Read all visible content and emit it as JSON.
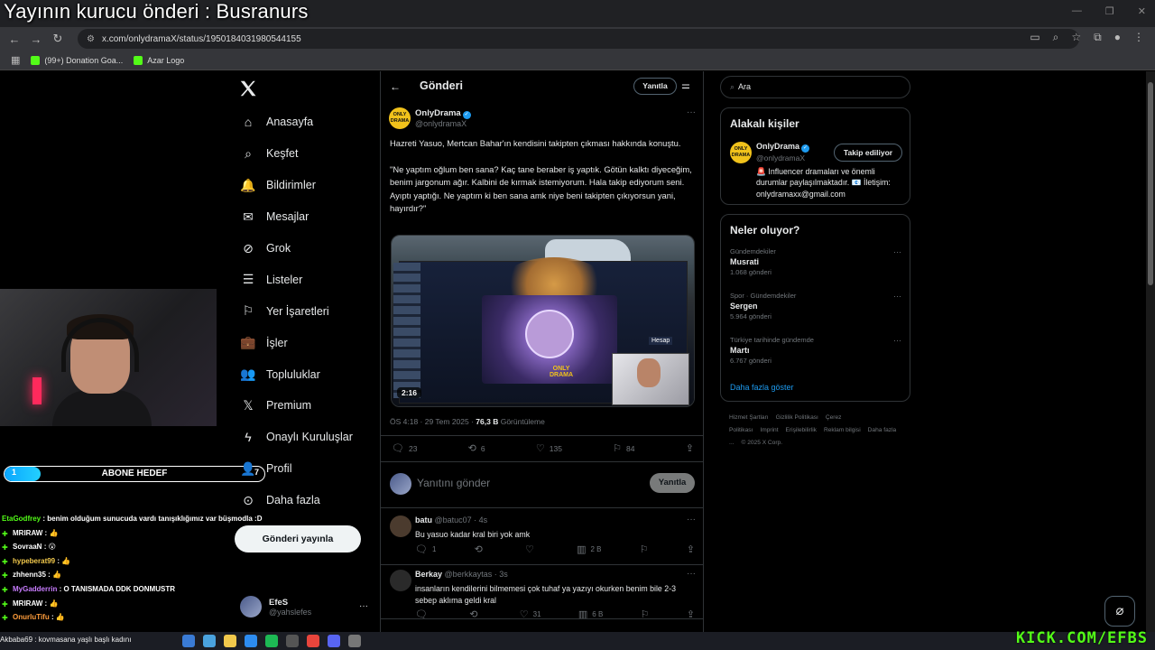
{
  "stream_title": "Yayının kurucu önderi : Busranurs",
  "browser": {
    "url": "x.com/onlydramaX/status/1950184031980544155",
    "bookmarks": [
      {
        "label": "(99+) Donation Goa...",
        "color": "#53fc18"
      },
      {
        "label": "Azar Logo",
        "color": "#53fc18"
      }
    ]
  },
  "stream_overlay": {
    "sub_goal": {
      "label": "ABONE HEDEF",
      "current": 1,
      "target": 7,
      "progress": 0.14
    },
    "chat": [
      {
        "user": "EtaGodfrey",
        "color": "#53fc18",
        "message": "benim olduğum sunucuda vardı tanışıklığımız var büşmodla :D"
      },
      {
        "user": "MRIRAW",
        "color": "#ffffff",
        "message": "👍"
      },
      {
        "user": "SovraaN",
        "color": "#ffffff",
        "message": "😮"
      },
      {
        "user": "hypeberat99",
        "color": "#f2c94c",
        "message": "👍"
      },
      {
        "user": "zhhenn35",
        "color": "#ffffff",
        "message": "👍"
      },
      {
        "user": "MyGadderrin",
        "color": "#c87cff",
        "message": "O TANISMADA DDK DONMUSTR"
      },
      {
        "user": "MRIRAW",
        "color": "#ffffff",
        "message": "👍"
      },
      {
        "user": "OnurluTifu",
        "color": "#ff9d3c",
        "message": "👍"
      }
    ],
    "ticker": "Akbaba69 : kovmasana yaşlı başlı kadını",
    "kick_watermark": "KICK.COM/EFBS"
  },
  "sidebar": {
    "items": [
      {
        "label": "Anasayfa",
        "icon": "home-icon"
      },
      {
        "label": "Keşfet",
        "icon": "search-icon"
      },
      {
        "label": "Bildirimler",
        "icon": "bell-icon"
      },
      {
        "label": "Mesajlar",
        "icon": "mail-icon"
      },
      {
        "label": "Grok",
        "icon": "grok-icon"
      },
      {
        "label": "Listeler",
        "icon": "list-icon"
      },
      {
        "label": "Yer İşaretleri",
        "icon": "bookmark-icon"
      },
      {
        "label": "İşler",
        "icon": "briefcase-icon"
      },
      {
        "label": "Topluluklar",
        "icon": "communities-icon"
      },
      {
        "label": "Premium",
        "icon": "x-icon"
      },
      {
        "label": "Onaylı Kuruluşlar",
        "icon": "lightning-icon"
      },
      {
        "label": "Profil",
        "icon": "profile-icon"
      },
      {
        "label": "Daha fazla",
        "icon": "more-icon"
      }
    ],
    "post_button": "Gönderi yayınla",
    "account": {
      "name": "EfeS",
      "handle": "@yahslefes"
    }
  },
  "main": {
    "title": "Gönderi",
    "reply_pill": "Yanıtla",
    "post": {
      "author": "OnlyDrama",
      "handle": "@onlydramaX",
      "text_1": "Hazreti Yasuo, Mertcan Bahar'ın kendisini takipten çıkması hakkında konuştu.",
      "text_2": "\"Ne yaptım oğlum ben sana? Kaç tane beraber iş yaptık. Götün kalktı diyeceğim, benim jargonum ağır. Kalbini de kırmak istemiyorum. Hala takip ediyorum seni. Ayıptı yaptığı. Ne yaptım ki ben sana amk niye beni takipten çıkıyorsun yani, hayırdır?\"",
      "video_duration": "2:16",
      "time": "ÖS 4:18 · 29 Tem 2025 · ",
      "views": "76,3 B",
      "views_label": " Görüntüleme",
      "replies": "23",
      "reposts": "6",
      "likes": "135",
      "bookmarks": "84"
    },
    "compose": {
      "placeholder": "Yanıtını gönder",
      "button": "Yanıtla"
    },
    "replies": [
      {
        "name": "batu",
        "handle": "@batuc07 · 4s",
        "text": "Bu yasuo kadar kral biri yok amk",
        "replies": "1",
        "reposts": "",
        "likes": "",
        "views": "2 B",
        "avatar_color": "#4b3b2e"
      },
      {
        "name": "Berkay",
        "handle": "@berkkaytas · 3s",
        "text": "insanların kendilerini bilmemesi çok tuhaf ya yazıyı okurken benim bile 2-3 sebep aklıma geldi  kral",
        "replies": "",
        "reposts": "",
        "likes": "31",
        "views": "6 B",
        "avatar_color": "#2a2a2a"
      }
    ]
  },
  "right": {
    "search_placeholder": "Ara",
    "relevant": {
      "title": "Alakalı kişiler",
      "name": "OnlyDrama",
      "handle": "@onlydramaX",
      "follow_button": "Takip ediliyor",
      "bio": "🚨 Influencer dramaları ve önemli durumlar paylaşılmaktadır. 📧 İletişim: onlydramaxx@gmail.com"
    },
    "trends": {
      "title": "Neler oluyor?",
      "items": [
        {
          "category": "Gündemdekiler",
          "name": "Musrati",
          "count": "1.068 gönderi"
        },
        {
          "category": "Spor · Gündemdekiler",
          "name": "Sergen",
          "count": "5.964 gönderi"
        },
        {
          "category": "Türkiye tarihinde gündemde",
          "name": "Martı",
          "count": "6.767 gönderi"
        }
      ],
      "show_more": "Daha fazla göster"
    },
    "footer": [
      "Hizmet Şartları",
      "Gizlilik Politikası",
      "Çerez Politikası",
      "Imprint",
      "Erişilebilirlik",
      "Reklam bilgisi",
      "Daha fazla ...",
      "© 2025 X Corp."
    ]
  }
}
